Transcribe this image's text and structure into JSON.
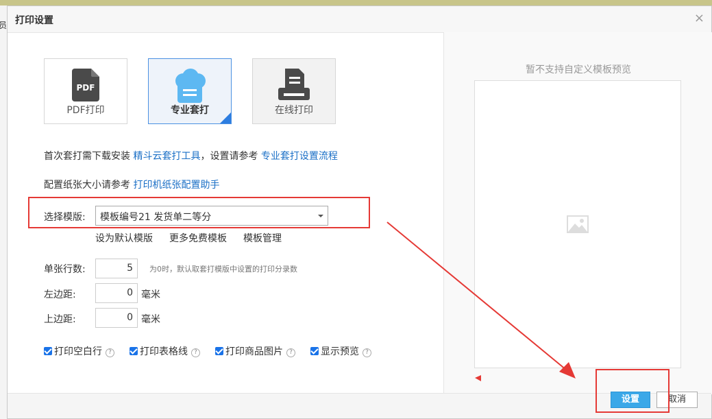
{
  "background": {
    "left_char": "员"
  },
  "dialog": {
    "title": "打印设置",
    "close_glyph": "×"
  },
  "modes": {
    "pdf": {
      "badge": "PDF",
      "label": "PDF打印"
    },
    "pro": {
      "label": "专业套打"
    },
    "online": {
      "label": "在线打印"
    }
  },
  "info": {
    "line1_prefix": "首次套打需下载安装 ",
    "line1_link1": "精斗云套打工具",
    "line1_mid": "，设置请参考 ",
    "line1_link2": "专业套打设置流程",
    "line2_prefix": "配置纸张大小请参考 ",
    "line2_link": "打印机纸张配置助手"
  },
  "template": {
    "label": "选择模版:",
    "selected": "模板编号21 发货单二等分",
    "links": [
      "设为默认模版",
      "更多免费模板",
      "模板管理"
    ]
  },
  "fields": {
    "rows_label": "单张行数:",
    "rows_value": "5",
    "rows_hint": "为0时，默认取套打模版中设置的打印分录数",
    "left_margin_label": "左边距:",
    "left_margin_value": "0",
    "top_margin_label": "上边距:",
    "top_margin_value": "0",
    "unit": "毫米"
  },
  "checkboxes": [
    {
      "label": "打印空白行",
      "checked": true
    },
    {
      "label": "打印表格线",
      "checked": true
    },
    {
      "label": "打印商品图片",
      "checked": true
    },
    {
      "label": "显示预览",
      "checked": true
    }
  ],
  "help_glyph": "?",
  "preview": {
    "title": "暂不支持自定义模板预览",
    "icon": "image-placeholder-icon"
  },
  "footer": {
    "confirm": "设置",
    "cancel": "取消"
  },
  "colors": {
    "link": "#1a6fc6",
    "primary_button": "#3ba8e8",
    "annotation_red": "#e53935",
    "selected_corner": "#2d7de0"
  }
}
